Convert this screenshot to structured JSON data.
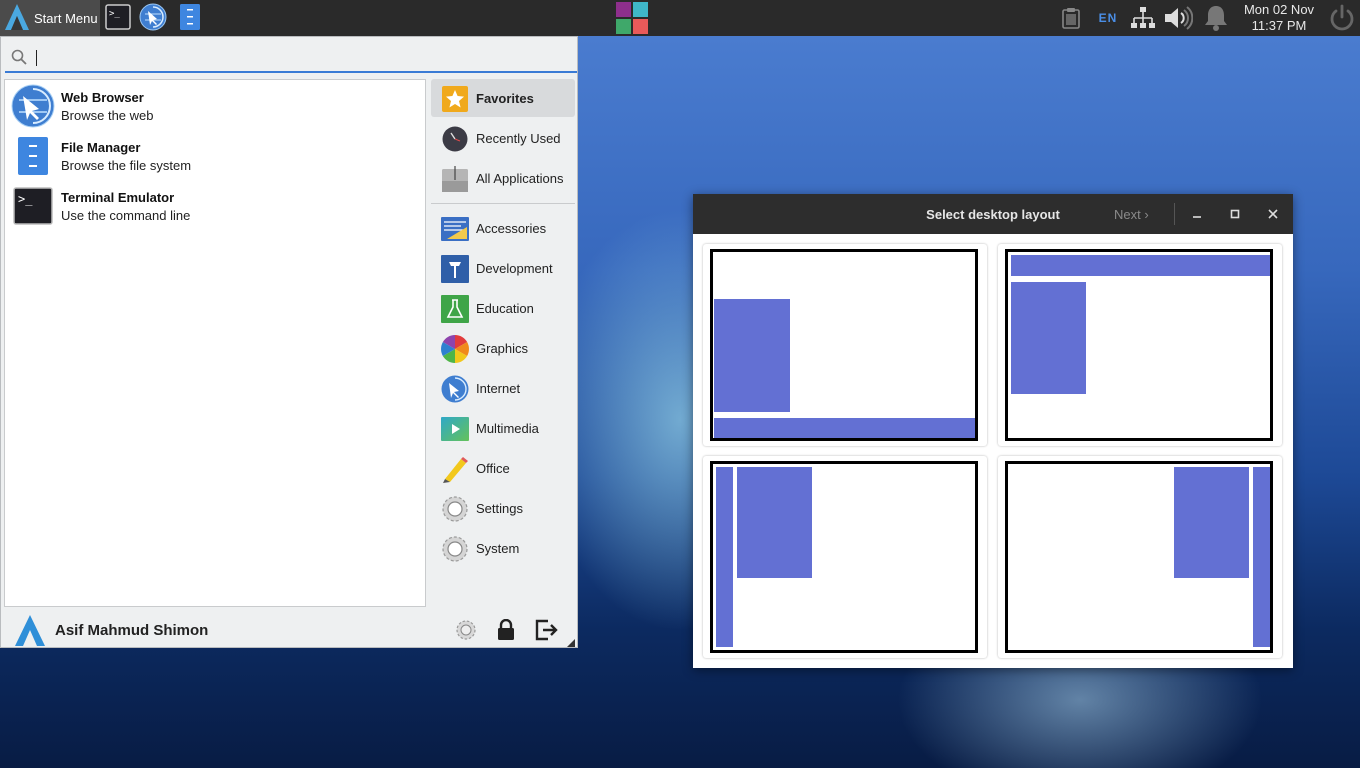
{
  "taskbar": {
    "start_label": "Start Menu",
    "launchers": [
      "terminal-icon",
      "web-browser-icon",
      "file-manager-icon"
    ],
    "tray": {
      "language": "EN",
      "clock_date": "Mon 02 Nov",
      "clock_time": "11:37 PM"
    }
  },
  "menu": {
    "search": {
      "value": "",
      "placeholder": ""
    },
    "favorites": [
      {
        "name": "Web Browser",
        "desc": "Browse the web",
        "icon": "web-browser-icon"
      },
      {
        "name": "File Manager",
        "desc": "Browse the file system",
        "icon": "file-manager-icon"
      },
      {
        "name": "Terminal Emulator",
        "desc": "Use the command line",
        "icon": "terminal-icon"
      }
    ],
    "categories_top": [
      {
        "label": "Favorites",
        "icon": "star-icon",
        "selected": true
      },
      {
        "label": "Recently Used",
        "icon": "clock-icon"
      },
      {
        "label": "All Applications",
        "icon": "all-applications-icon"
      }
    ],
    "categories": [
      {
        "label": "Accessories",
        "icon": "accessories-icon"
      },
      {
        "label": "Development",
        "icon": "development-icon"
      },
      {
        "label": "Education",
        "icon": "education-icon"
      },
      {
        "label": "Graphics",
        "icon": "graphics-icon"
      },
      {
        "label": "Internet",
        "icon": "internet-icon"
      },
      {
        "label": "Multimedia",
        "icon": "multimedia-icon"
      },
      {
        "label": "Office",
        "icon": "office-icon"
      },
      {
        "label": "Settings",
        "icon": "settings-icon"
      },
      {
        "label": "System",
        "icon": "system-icon"
      }
    ],
    "user": {
      "name": "Asif Mahmud Shimon"
    }
  },
  "layout_dialog": {
    "title": "Select desktop layout",
    "next_label": "Next",
    "layouts": [
      "bottom-panel-layout",
      "top-panel-layout",
      "left-panel-layout",
      "right-panel-layout"
    ]
  },
  "colors": {
    "accent": "#3a7bd5",
    "taskbar": "#2a2a2a",
    "layout_block": "#6370d3",
    "start_menu_bg": "#eef0f1"
  }
}
